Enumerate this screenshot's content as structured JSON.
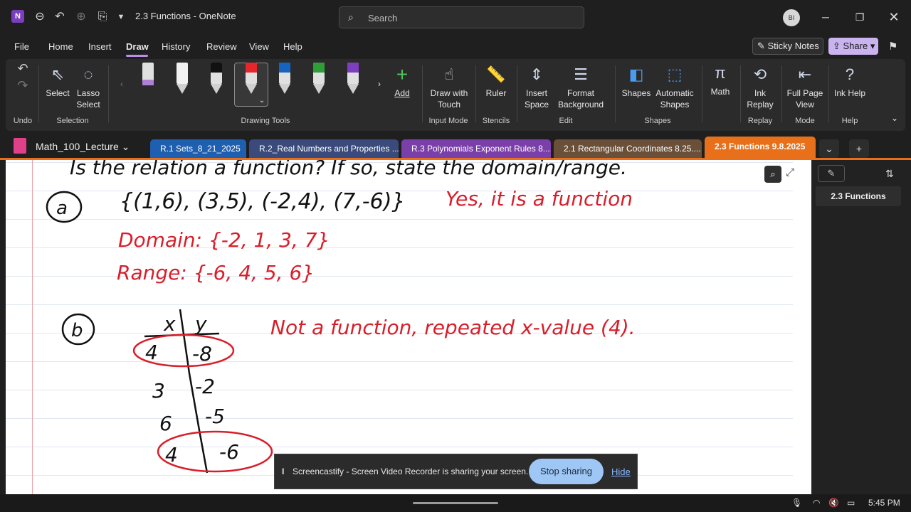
{
  "titlebar": {
    "app_logo": "N",
    "title": "2.3 Functions - OneNote",
    "search_placeholder": "Search",
    "avatar_initials": "BI"
  },
  "menu": {
    "items": [
      "File",
      "Home",
      "Insert",
      "Draw",
      "History",
      "Review",
      "View",
      "Help"
    ],
    "active": "Draw",
    "sticky_notes": "Sticky Notes",
    "share": "Share"
  },
  "ribbon": {
    "undo_group": "Undo",
    "select": "Select",
    "lasso_select": "Lasso Select",
    "selection_group": "Selection",
    "drawing_tools_group": "Drawing Tools",
    "add": "Add",
    "draw_with_touch": "Draw with Touch",
    "input_mode_group": "Input Mode",
    "ruler": "Ruler",
    "stencils_group": "Stencils",
    "insert_space": "Insert Space",
    "format_background": "Format Background",
    "edit_group": "Edit",
    "shapes": "Shapes",
    "automatic_shapes": "Automatic Shapes",
    "shapes_group": "Shapes",
    "math": "Math",
    "ink_replay": "Ink Replay",
    "replay_group": "Replay",
    "full_page_view": "Full Page View",
    "mode_group": "Mode",
    "ink_help": "Ink Help",
    "help_group": "Help",
    "pen_colors": [
      "#b07fd6",
      "#ffffff",
      "#111111",
      "#e5262b",
      "#1565c0",
      "#2e9d3a",
      "#7e3fbf"
    ]
  },
  "sections": {
    "notebook": "Math_100_Lecture",
    "tabs": [
      {
        "label": "R.1 Sets_8_21_2025",
        "color": "#1f5fb0"
      },
      {
        "label": "R.2_Real Numbers and Properties ...",
        "color": "#3a4a7a"
      },
      {
        "label": "R.3 Polynomials Exponent Rules 8....",
        "color": "#7a3fa8"
      },
      {
        "label": "2.1 Rectangular Coordinates 8.25....",
        "color": "#6a5038"
      },
      {
        "label": "2.3 Functions 9.8.2025",
        "color": "#e8701a"
      }
    ]
  },
  "pages": {
    "current": "2.3 Functions"
  },
  "notes": {
    "heading": "Is the relation a function? If so, state the domain/range.",
    "part_a_label": "a",
    "part_a_set": "{(1,6), (3,5), (-2,4), (7,-6)}",
    "part_a_answer": "Yes, it is a function",
    "domain": "Domain: {-2, 1, 3, 7}",
    "range": "Range: {-6, 4, 5, 6}",
    "part_b_label": "b",
    "table_header_x": "x",
    "table_header_y": "y",
    "table_rows": [
      {
        "x": "4",
        "y": "-8"
      },
      {
        "x": "3",
        "y": "-2"
      },
      {
        "x": "6",
        "y": "-5"
      },
      {
        "x": "4",
        "y": "-6"
      }
    ],
    "part_b_answer": "Not a function, repeated x-value (4)."
  },
  "share_bar": {
    "message": "Screencastify - Screen Video Recorder is sharing your screen.",
    "stop": "Stop sharing",
    "hide": "Hide"
  },
  "taskbar": {
    "time": "5:45 PM"
  }
}
